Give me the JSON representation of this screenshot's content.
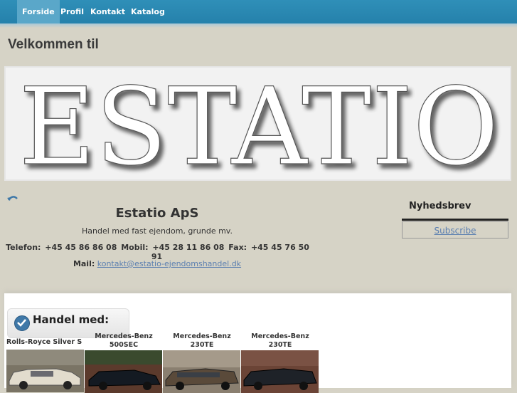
{
  "nav": {
    "items": [
      {
        "label": "Forside"
      },
      {
        "label": "Profil"
      },
      {
        "label": "Kontakt"
      },
      {
        "label": "Katalog"
      }
    ],
    "active_color": "#5aa7c9",
    "bar_color": "#2f8fb8"
  },
  "page": {
    "welcome": "Velkommen til"
  },
  "banner": {
    "text": "ESTATIO"
  },
  "company": {
    "name": "Estatio ApS",
    "tagline": "Handel med fast ejendom, grunde mv.",
    "contact": {
      "phone_label": "Telefon:",
      "phone": "+45 45 86 86 08",
      "mobile_label": "Mobil:",
      "mobile": "+45 28 11 86 08",
      "fax_label": "Fax:",
      "fax": "+45 45 76 50 91",
      "mail_label": "Mail:",
      "mail": "kontakt@estatio-ejendomshandel.dk"
    }
  },
  "newsletter": {
    "title": "Nyhedsbrev",
    "subscribe": "Subscribe"
  },
  "handel": {
    "title": "Handel med:",
    "cars": [
      {
        "name": "Rolls-Royce Silver S",
        "photo_color": "#d8d0c0"
      },
      {
        "name": "Mercedes-Benz 500SEC",
        "photo_color": "#1d2530"
      },
      {
        "name": "Mercedes-Benz 230TE",
        "photo_color": "#6a5a48"
      },
      {
        "name": "Mercedes-Benz 230TE",
        "photo_color": "#2a2e34"
      }
    ]
  },
  "icons": {
    "arrow": "curved-arrow-icon",
    "check": "checkmark-icon"
  }
}
